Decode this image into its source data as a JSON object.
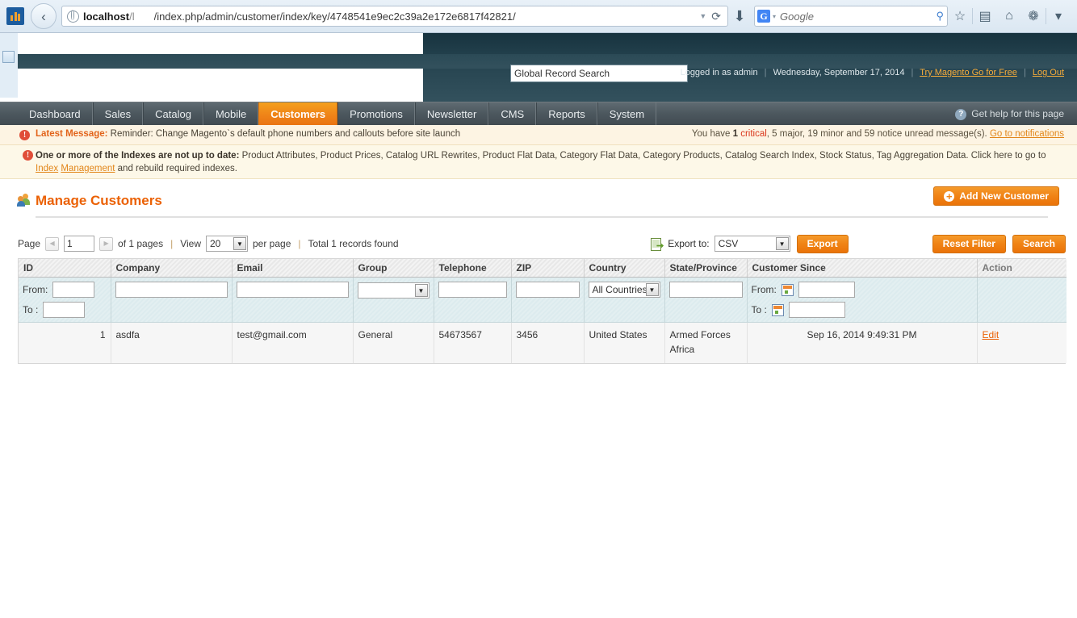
{
  "browser": {
    "back_label": "‹",
    "url_host": "localhost",
    "url_host_dim": "/l",
    "url_path": "/index.php/admin/customer/index/key/4748541e9ec2c39a2e172e6817f42821/",
    "url_dropdown": "▼",
    "reload_label": "⟳",
    "download_label": "⬇",
    "search_engine": "G",
    "search_caret": "▾",
    "search_placeholder": "Google",
    "magnifier": "⚲",
    "bookmark_icon": "☆",
    "reader_icon": "▤",
    "home_icon": "⌂",
    "addon_icon": "❁",
    "overflow_icon": "▾"
  },
  "header": {
    "global_search_value": "Global Record Search",
    "logged_in_as": "Logged in as admin",
    "date": "Wednesday, September 17, 2014",
    "try_magento": "Try Magento Go for Free",
    "log_out": "Log Out",
    "separator": "|"
  },
  "nav": {
    "items": [
      {
        "label": "Dashboard",
        "active": false
      },
      {
        "label": "Sales",
        "active": false
      },
      {
        "label": "Catalog",
        "active": false
      },
      {
        "label": "Mobile",
        "active": false
      },
      {
        "label": "Customers",
        "active": true
      },
      {
        "label": "Promotions",
        "active": false
      },
      {
        "label": "Newsletter",
        "active": false
      },
      {
        "label": "CMS",
        "active": false
      },
      {
        "label": "Reports",
        "active": false
      },
      {
        "label": "System",
        "active": false
      }
    ],
    "help_label": "Get help for this page",
    "help_icon_glyph": "?"
  },
  "messages": {
    "warn_glyph": "!",
    "latest_label": "Latest Message:",
    "latest_text": " Reminder: Change Magento`s default phone numbers and callouts before site launch",
    "unread_prefix": "You have ",
    "unread_critical_count": "1",
    "unread_critical_word": " critical",
    "unread_rest": ", 5 major, 19 minor and 59 notice unread message(s). ",
    "unread_link": "Go to notifications",
    "index_label": "One or more of the Indexes are not up to date:",
    "index_text": " Product Attributes, Product Prices, Catalog URL Rewrites, Product Flat Data, Category Flat Data, Category Products, Catalog Search Index, Stock Status, Tag Aggregation Data. Click here to go to ",
    "index_link1": "Index",
    "index_link2": "Management",
    "index_tail": " and rebuild required indexes."
  },
  "page": {
    "title": "Manage Customers",
    "add_button": "Add New Customer",
    "add_button_glyph": "+"
  },
  "toolbar": {
    "page_label": "Page",
    "prev_glyph": "◀",
    "next_glyph": "▶",
    "page_value": "1",
    "of_pages": "of 1 pages",
    "view_label": "View",
    "per_page_value": "20",
    "per_page_label": "per page",
    "total_records": "Total 1 records found",
    "divider": "|",
    "export_to_label": "Export to:",
    "export_format": "CSV",
    "export_button": "Export",
    "reset_filter_button": "Reset Filter",
    "search_button": "Search",
    "select_arrow": "▼"
  },
  "grid": {
    "columns": [
      "ID",
      "Company",
      "Email",
      "Group",
      "Telephone",
      "ZIP",
      "Country",
      "State/Province",
      "Customer Since",
      "Action"
    ],
    "filters": {
      "id_from_label": "From:",
      "id_to_label": "To :",
      "id_from_value": "",
      "id_to_value": "",
      "company_value": "",
      "email_value": "",
      "group_value": "",
      "telephone_value": "",
      "zip_value": "",
      "country_value": "All Countries",
      "state_value": "",
      "since_from_label": "From:",
      "since_to_label": "To :",
      "since_from_value": "",
      "since_to_value": ""
    },
    "rows": [
      {
        "id": "1",
        "company": "asdfa",
        "email": "test@gmail.com",
        "group": "General",
        "telephone": "54673567",
        "zip": "3456",
        "country": "United States",
        "state": "Armed Forces Africa",
        "customer_since": "Sep 16, 2014 9:49:31 PM",
        "action": "Edit"
      }
    ]
  },
  "colors": {
    "accent_orange": "#eb6104",
    "nav_active": "#ef8318",
    "header_dark": "#25434f",
    "warn_bg": "#fdf4e3",
    "critical_red": "#d9361b"
  }
}
